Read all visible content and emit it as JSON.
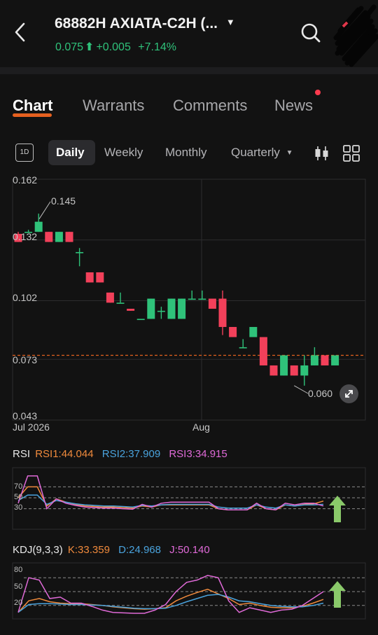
{
  "header": {
    "back_icon": "chevron-left-icon",
    "title": "68882H  AXIATA-C2H (...",
    "price": "0.075",
    "change": "+0.005",
    "change_pct": "+7.14%",
    "up_color": "#2fc27a",
    "down_color": "#f2405a"
  },
  "tabs": [
    {
      "label": "Chart",
      "active": true
    },
    {
      "label": "Warrants"
    },
    {
      "label": "Comments"
    },
    {
      "label": "News",
      "has_dot": true
    }
  ],
  "periods": {
    "box_icon_label": "1D",
    "items": [
      "Daily",
      "Weekly",
      "Monthly",
      "Quarterly"
    ],
    "selected": "Daily"
  },
  "chart_data": {
    "type": "candlestick",
    "y_ticks": [
      "0.162",
      "0.132",
      "0.102",
      "0.073",
      "0.043"
    ],
    "ylim": [
      0.043,
      0.162
    ],
    "x_labels": [
      "Jul 2026",
      "Aug"
    ],
    "max_annotation": "0.145",
    "min_annotation": "0.060",
    "last_price_line": 0.075,
    "candles": [
      {
        "o": 0.135,
        "h": 0.136,
        "l": 0.131,
        "c": 0.131
      },
      {
        "o": 0.136,
        "h": 0.137,
        "l": 0.136,
        "c": 0.136
      },
      {
        "o": 0.136,
        "h": 0.145,
        "l": 0.136,
        "c": 0.141
      },
      {
        "o": 0.136,
        "h": 0.136,
        "l": 0.131,
        "c": 0.131
      },
      {
        "o": 0.131,
        "h": 0.136,
        "l": 0.131,
        "c": 0.136
      },
      {
        "o": 0.136,
        "h": 0.136,
        "l": 0.131,
        "c": 0.131
      },
      {
        "o": 0.126,
        "h": 0.128,
        "l": 0.119,
        "c": 0.126
      },
      {
        "o": 0.116,
        "h": 0.116,
        "l": 0.111,
        "c": 0.111
      },
      {
        "o": 0.116,
        "h": 0.116,
        "l": 0.111,
        "c": 0.111
      },
      {
        "o": 0.106,
        "h": 0.106,
        "l": 0.101,
        "c": 0.101
      },
      {
        "o": 0.101,
        "h": 0.106,
        "l": 0.101,
        "c": 0.101
      },
      {
        "o": 0.098,
        "h": 0.098,
        "l": 0.097,
        "c": 0.097
      },
      {
        "o": 0.093,
        "h": 0.093,
        "l": 0.093,
        "c": 0.093
      },
      {
        "o": 0.093,
        "h": 0.103,
        "l": 0.093,
        "c": 0.103
      },
      {
        "o": 0.097,
        "h": 0.099,
        "l": 0.093,
        "c": 0.097
      },
      {
        "o": 0.093,
        "h": 0.103,
        "l": 0.093,
        "c": 0.103
      },
      {
        "o": 0.093,
        "h": 0.103,
        "l": 0.093,
        "c": 0.103
      },
      {
        "o": 0.103,
        "h": 0.107,
        "l": 0.103,
        "c": 0.103
      },
      {
        "o": 0.103,
        "h": 0.107,
        "l": 0.103,
        "c": 0.103
      },
      {
        "o": 0.103,
        "h": 0.098,
        "l": 0.098,
        "c": 0.098
      },
      {
        "o": 0.103,
        "h": 0.107,
        "l": 0.085,
        "c": 0.089
      },
      {
        "o": 0.089,
        "h": 0.089,
        "l": 0.084,
        "c": 0.084
      },
      {
        "o": 0.079,
        "h": 0.083,
        "l": 0.079,
        "c": 0.079
      },
      {
        "o": 0.084,
        "h": 0.084,
        "l": 0.084,
        "c": 0.089
      },
      {
        "o": 0.084,
        "h": 0.084,
        "l": 0.07,
        "c": 0.07
      },
      {
        "o": 0.07,
        "h": 0.07,
        "l": 0.065,
        "c": 0.065
      },
      {
        "o": 0.065,
        "h": 0.075,
        "l": 0.065,
        "c": 0.075
      },
      {
        "o": 0.07,
        "h": 0.07,
        "l": 0.065,
        "c": 0.065
      },
      {
        "o": 0.065,
        "h": 0.075,
        "l": 0.06,
        "c": 0.07
      },
      {
        "o": 0.07,
        "h": 0.079,
        "l": 0.07,
        "c": 0.075
      },
      {
        "o": 0.075,
        "h": 0.075,
        "l": 0.07,
        "c": 0.07
      },
      {
        "o": 0.07,
        "h": 0.075,
        "l": 0.07,
        "c": 0.075
      }
    ]
  },
  "rsi": {
    "label": "RSI",
    "v1": "RSI1:44.044",
    "v2": "RSI2:37.909",
    "v3": "RSI3:34.915",
    "c1": "#f08a3c",
    "c2": "#4aa3dd",
    "c3": "#e06ad8",
    "levels": [
      "70",
      "50",
      "30"
    ],
    "series1": [
      50,
      70,
      70,
      35,
      48,
      42,
      38,
      35,
      34,
      33,
      33,
      32,
      31,
      35,
      33,
      37,
      37,
      37,
      37,
      37,
      37,
      30,
      28,
      28,
      28,
      37,
      30,
      28,
      37,
      35,
      38,
      39,
      44
    ],
    "series2": [
      45,
      55,
      55,
      38,
      45,
      42,
      39,
      37,
      36,
      35,
      35,
      34,
      33,
      36,
      35,
      37,
      38,
      38,
      38,
      38,
      38,
      33,
      31,
      31,
      31,
      37,
      33,
      31,
      37,
      35,
      37,
      37,
      38
    ],
    "series3": [
      40,
      90,
      90,
      30,
      48,
      40,
      36,
      33,
      32,
      31,
      31,
      30,
      29,
      38,
      33,
      40,
      42,
      42,
      42,
      42,
      42,
      30,
      28,
      28,
      28,
      40,
      30,
      28,
      40,
      37,
      40,
      40,
      35
    ]
  },
  "kdj": {
    "label": "KDJ(9,3,3)",
    "k": "K:33.359",
    "d": "D:24.968",
    "j": "J:50.140",
    "ck": "#f08a3c",
    "cd": "#4aa3dd",
    "cj": "#e06ad8",
    "levels": [
      "80",
      "50",
      "20"
    ],
    "series_k": [
      5,
      30,
      35,
      28,
      25,
      24,
      24,
      22,
      20,
      17,
      15,
      13,
      12,
      13,
      15,
      30,
      40,
      48,
      55,
      45,
      35,
      22,
      25,
      20,
      16,
      15,
      15,
      18,
      25,
      33
    ],
    "series_d": [
      5,
      22,
      24,
      24,
      23,
      22,
      22,
      21,
      20,
      18,
      16,
      14,
      13,
      13,
      14,
      20,
      28,
      35,
      42,
      44,
      38,
      30,
      28,
      24,
      20,
      18,
      17,
      17,
      20,
      25
    ],
    "series_j": [
      5,
      80,
      75,
      35,
      38,
      25,
      25,
      18,
      10,
      5,
      4,
      3,
      3,
      10,
      22,
      50,
      70,
      75,
      85,
      80,
      30,
      5,
      15,
      10,
      5,
      10,
      12,
      20,
      35,
      50
    ]
  }
}
